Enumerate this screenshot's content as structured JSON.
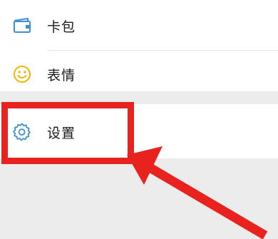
{
  "menu": {
    "items": [
      {
        "label": "卡包",
        "icon": "card-wallet-icon"
      },
      {
        "label": "表情",
        "icon": "smiley-face-icon"
      },
      {
        "label": "设置",
        "icon": "gear-icon"
      }
    ]
  },
  "annotation": {
    "highlight_target": "设置",
    "highlight_color": "#e8231f"
  },
  "colors": {
    "icon_blue": "#3d8fd8",
    "icon_yellow": "#f0b400",
    "background": "#ececec"
  }
}
